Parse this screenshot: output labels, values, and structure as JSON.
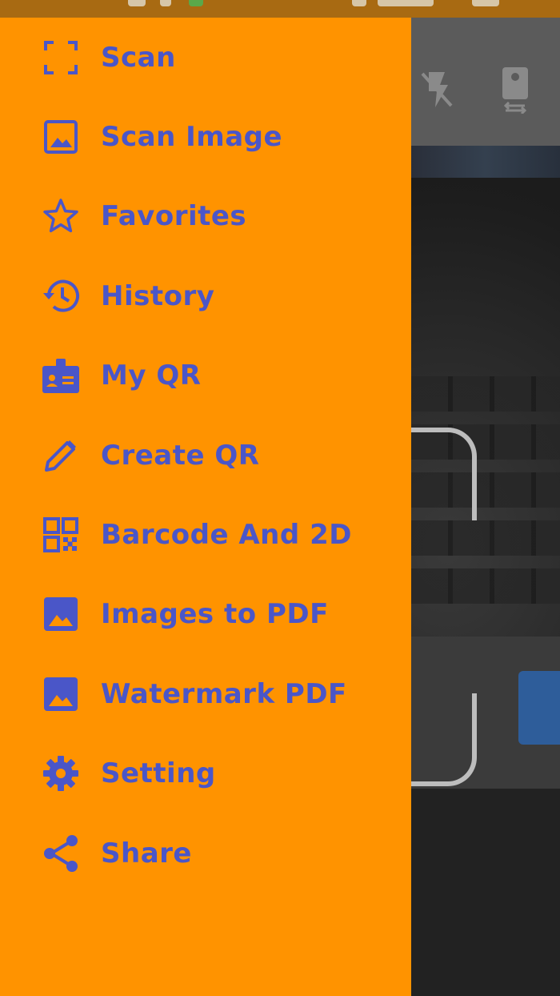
{
  "colors": {
    "drawer_background": "#ff9300",
    "menu_text_and_icons": "#4a56c8",
    "status_bar": "#a86a12",
    "camera_frame": "#bdbdbd"
  },
  "drawer": {
    "items": [
      {
        "label": "Scan",
        "icon": "scan-frame-icon"
      },
      {
        "label": "Scan Image",
        "icon": "image-icon"
      },
      {
        "label": "Favorites",
        "icon": "star-icon"
      },
      {
        "label": "History",
        "icon": "history-icon"
      },
      {
        "label": "My QR",
        "icon": "id-badge-icon"
      },
      {
        "label": "Create QR",
        "icon": "pencil-icon"
      },
      {
        "label": "Barcode And 2D",
        "icon": "qr-code-icon"
      },
      {
        "label": "Images to PDF",
        "icon": "photo-icon"
      },
      {
        "label": "Watermark PDF",
        "icon": "photo-icon"
      },
      {
        "label": "Setting",
        "icon": "gear-icon"
      },
      {
        "label": "Share",
        "icon": "share-icon"
      }
    ]
  },
  "camera_toolbar": {
    "icons": [
      "flash-off-icon",
      "switch-camera-icon"
    ]
  }
}
